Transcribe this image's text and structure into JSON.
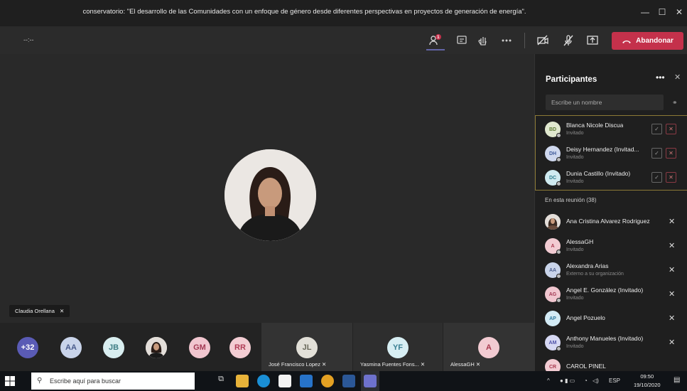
{
  "window": {
    "title": "conservatorio: \"El desarrollo de las Comunidades con un enfoque de género desde diferentes perspectivas en proyectos de generación de energía\".",
    "minimize": "—",
    "maximize": "☐",
    "close": "✕"
  },
  "toolbar": {
    "timer": "--:--",
    "participants_badge": "1",
    "leave_label": "Abandonar"
  },
  "stage": {
    "speaker_name": "Claudia Orellana"
  },
  "strip": {
    "overflow": "+32",
    "avatars": [
      "AA",
      "JB",
      "GM",
      "RR"
    ],
    "tiles": [
      {
        "initials": "JL",
        "name": "José Francisco Lopez"
      },
      {
        "initials": "YF",
        "name": "Yasmina Fuentes Fons..."
      },
      {
        "initials": "A",
        "name": "AlessaGH"
      }
    ]
  },
  "panel": {
    "title": "Participantes",
    "search_placeholder": "Escribe un nombre",
    "lobby": [
      {
        "initials": "BD",
        "name": "Blanca Nicole Discua",
        "status": "Invitado"
      },
      {
        "initials": "DH",
        "name": "Deisy Hernandez (Invitad...",
        "status": "Invitado"
      },
      {
        "initials": "DC",
        "name": "Dunia Castillo (Invitado)",
        "status": "Invitado"
      }
    ],
    "section_label": "En esta reunión (38)",
    "members": [
      {
        "initials": "",
        "name": "Ana Cristina Alvarez Rodriguez",
        "status": ""
      },
      {
        "initials": "A",
        "name": "AlessaGH",
        "status": "Invitado"
      },
      {
        "initials": "AA",
        "name": "Alexandra Arias",
        "status": "Externo a su organización"
      },
      {
        "initials": "AG",
        "name": "Angel E. González (Invitado)",
        "status": "Invitado"
      },
      {
        "initials": "AP",
        "name": "Angel Pozuelo",
        "status": ""
      },
      {
        "initials": "AM",
        "name": "Anthony Manueles (Invitado)",
        "status": "Invitado"
      },
      {
        "initials": "CR",
        "name": "CAROL PINEL",
        "status": ""
      }
    ]
  },
  "taskbar": {
    "search_placeholder": "Escribe aquí para buscar",
    "lang": "ESP",
    "time": "09:50",
    "date": "19/10/2020"
  },
  "colors": {
    "leave": "#c4314b",
    "accent": "#6264a7"
  }
}
